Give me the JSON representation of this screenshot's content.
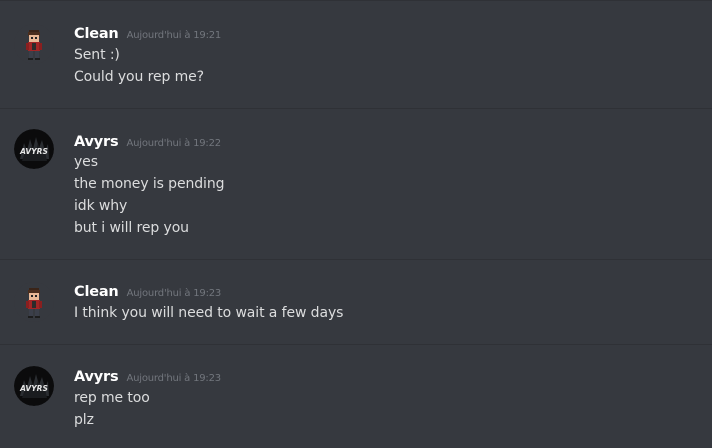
{
  "messages": [
    {
      "author": "Clean",
      "avatar_icon": "pixel-character-avatar",
      "timestamp": "Aujourd'hui à 19:21",
      "lines": [
        "Sent :)",
        "Could you rep me?"
      ]
    },
    {
      "author": "Avyrs",
      "avatar_icon": "avyrs-logo-avatar",
      "avatar_text": "AVYRS",
      "timestamp": "Aujourd'hui à 19:22",
      "lines": [
        "yes",
        "the money is pending",
        "idk why",
        "but i will rep you"
      ]
    },
    {
      "author": "Clean",
      "avatar_icon": "pixel-character-avatar",
      "timestamp": "Aujourd'hui à 19:23",
      "lines": [
        "I think you will need to wait a few days"
      ]
    },
    {
      "author": "Avyrs",
      "avatar_icon": "avyrs-logo-avatar",
      "avatar_text": "AVYRS",
      "timestamp": "Aujourd'hui à 19:23",
      "lines": [
        "rep me too",
        "plz"
      ]
    }
  ],
  "colors": {
    "background": "#36393f",
    "divider": "#2f3136",
    "username": "#ffffff",
    "timestamp": "#72767d",
    "message_text": "#dcddde"
  }
}
